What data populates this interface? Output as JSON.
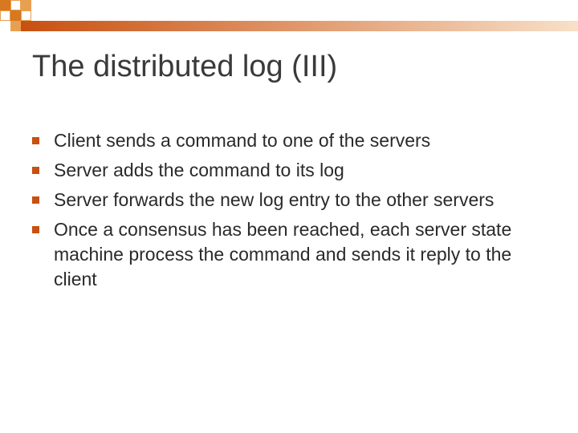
{
  "title": "The distributed log (III)",
  "bullets": [
    "Client sends a  command to one of the servers",
    "Server adds the command to its log",
    "Server forwards the new log entry to the other servers",
    "Once a consensus has been reached, each server state machine process the command and sends it reply to the client"
  ],
  "colors": {
    "accent": "#c85010",
    "accent_light": "#e8a050"
  }
}
